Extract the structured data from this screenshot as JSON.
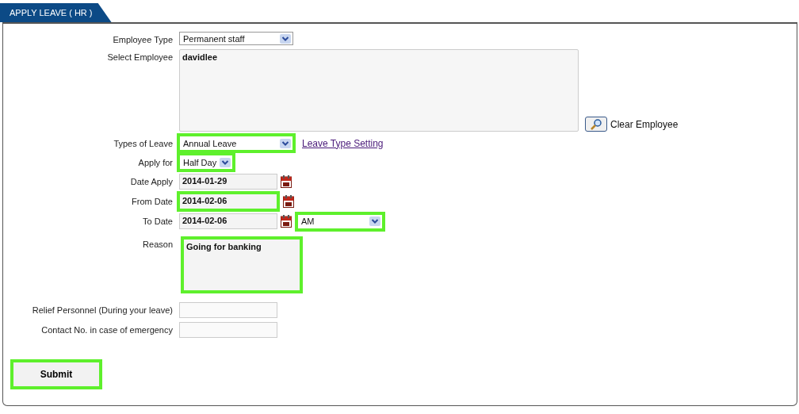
{
  "tab": {
    "label": "APPLY LEAVE ( HR )",
    "selected": true
  },
  "rows": [
    {
      "label": "Employee Type",
      "kind": "select",
      "value": "Permanent staff",
      "highlighted": false
    },
    {
      "label": "Select Employee",
      "kind": "area",
      "value": "davidlee",
      "highlighted": false,
      "action": "Clear Employee"
    },
    {
      "label": "Types of Leave",
      "kind": "select",
      "value": "Annual Leave",
      "highlighted": true,
      "link": "Leave Type Setting"
    },
    {
      "label": "Apply for",
      "kind": "short-select",
      "value": "Half Day",
      "highlighted": true
    },
    {
      "label": "Date Apply",
      "kind": "date",
      "value": "2014-01-29",
      "highlighted": false
    },
    {
      "label": "From Date",
      "kind": "date",
      "value": "2014-02-06",
      "highlighted": true
    },
    {
      "label": "To Date",
      "kind": "date",
      "value": "2014-02-06",
      "highlighted": false,
      "period": {
        "value": "AM",
        "highlighted": true
      }
    },
    {
      "label": "Reason",
      "kind": "reason",
      "value": "Going for banking",
      "highlighted": true
    },
    {
      "label": "Relief Personnel (During your leave)",
      "kind": "text",
      "highlighted": false
    },
    {
      "label": "Contact No. in case of emergency",
      "kind": "text",
      "highlighted": false
    }
  ],
  "submit": {
    "label": "Submit",
    "highlighted": true
  }
}
